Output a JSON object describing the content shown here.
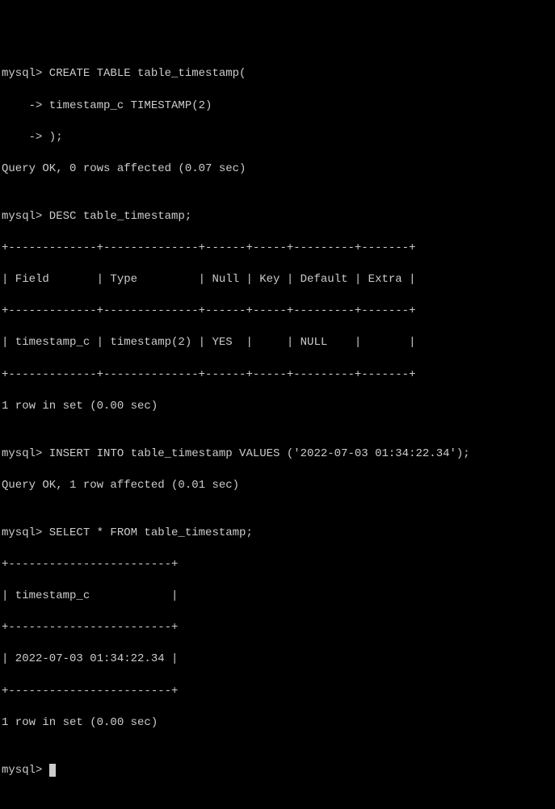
{
  "lines": {
    "l01": "mysql> CREATE TABLE table_timestamp(",
    "l02": "    -> timestamp_c TIMESTAMP(2)",
    "l03": "    -> );",
    "l04": "Query OK, 0 rows affected (0.07 sec)",
    "l05": "",
    "l06": "mysql> DESC table_timestamp;",
    "l07": "+-------------+--------------+------+-----+---------+-------+",
    "l08": "| Field       | Type         | Null | Key | Default | Extra |",
    "l09": "+-------------+--------------+------+-----+---------+-------+",
    "l10": "| timestamp_c | timestamp(2) | YES  |     | NULL    |       |",
    "l11": "+-------------+--------------+------+-----+---------+-------+",
    "l12": "1 row in set (0.00 sec)",
    "l13": "",
    "l14": "mysql> INSERT INTO table_timestamp VALUES ('2022-07-03 01:34:22.34');",
    "l15": "Query OK, 1 row affected (0.01 sec)",
    "l16": "",
    "l17": "mysql> SELECT * FROM table_timestamp;",
    "l18": "+------------------------+",
    "l19": "| timestamp_c            |",
    "l20": "+------------------------+",
    "l21": "| 2022-07-03 01:34:22.34 |",
    "l22": "+------------------------+",
    "l23": "1 row in set (0.00 sec)",
    "l24": "",
    "l25": "mysql> "
  }
}
